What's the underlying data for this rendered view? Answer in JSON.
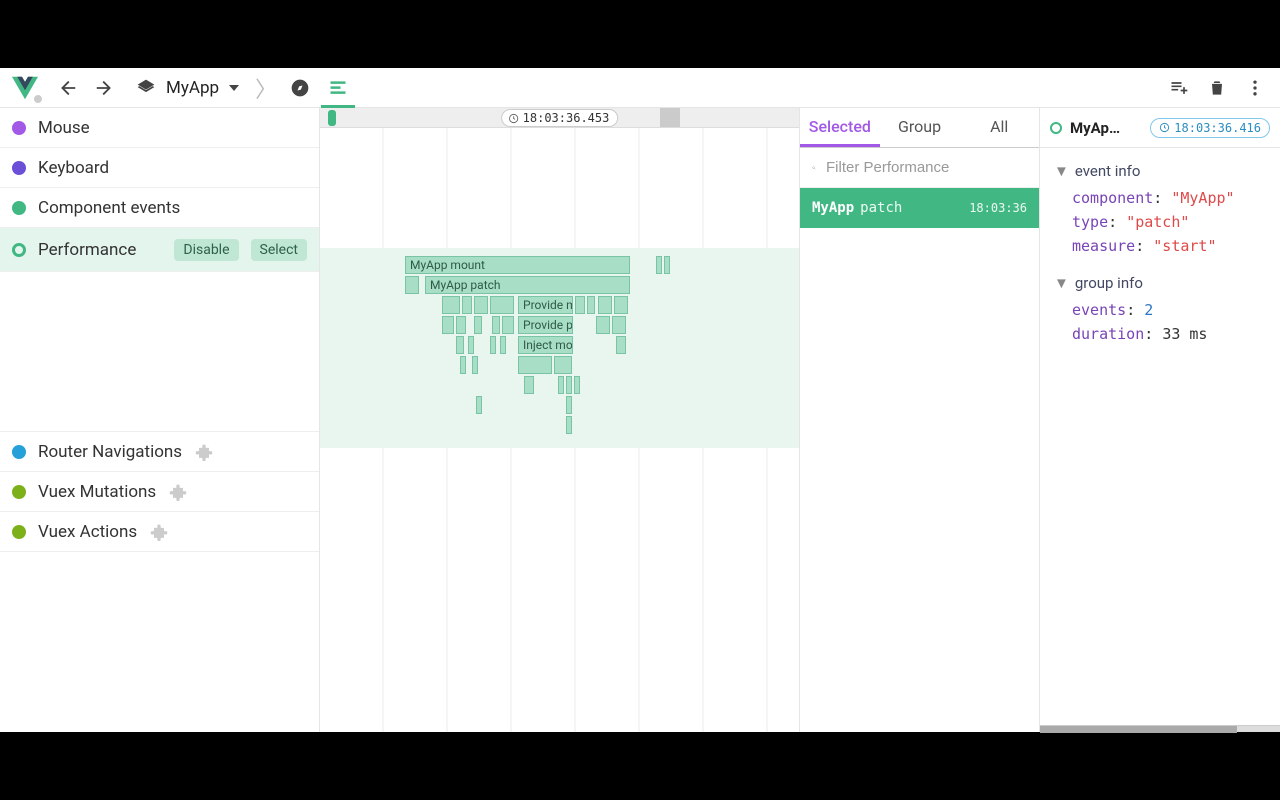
{
  "toolbar": {
    "app_name": "MyApp"
  },
  "sidebar": {
    "items": [
      {
        "label": "Mouse",
        "color": "#a259e6"
      },
      {
        "label": "Keyboard",
        "color": "#6b4fd6"
      },
      {
        "label": "Component events",
        "color": "#41b883"
      },
      {
        "label": "Performance",
        "active": true,
        "pills": [
          "Disable",
          "Select"
        ]
      },
      {
        "label": "Router Navigations",
        "color": "#25a0d8",
        "plugin": true
      },
      {
        "label": "Vuex Mutations",
        "color": "#7cb11a",
        "plugin": true
      },
      {
        "label": "Vuex Actions",
        "color": "#7cb11a",
        "plugin": true
      }
    ]
  },
  "timeline": {
    "marker_ts": "18:03:36.453",
    "flame": {
      "r1": "MyApp mount",
      "r2": "MyApp patch",
      "r3": "Provide m",
      "r4": "Provide p",
      "r5": "Inject mou"
    }
  },
  "events": {
    "tabs": [
      "Selected",
      "Group",
      "All"
    ],
    "filter_placeholder": "Filter Performance",
    "list": [
      {
        "name": "MyApp",
        "subtitle": "patch",
        "time": "18:03:36"
      }
    ]
  },
  "details": {
    "title": "MyAp…",
    "ts": "18:03:36.416",
    "event_info_title": "event info",
    "group_info_title": "group info",
    "event_info": {
      "component_label": "component",
      "component_value": "\"MyApp\"",
      "type_label": "type",
      "type_value": "\"patch\"",
      "measure_label": "measure",
      "measure_value": "\"start\""
    },
    "group_info": {
      "events_label": "events",
      "events_value": "2",
      "duration_label": "duration",
      "duration_value": "33 ms"
    }
  }
}
